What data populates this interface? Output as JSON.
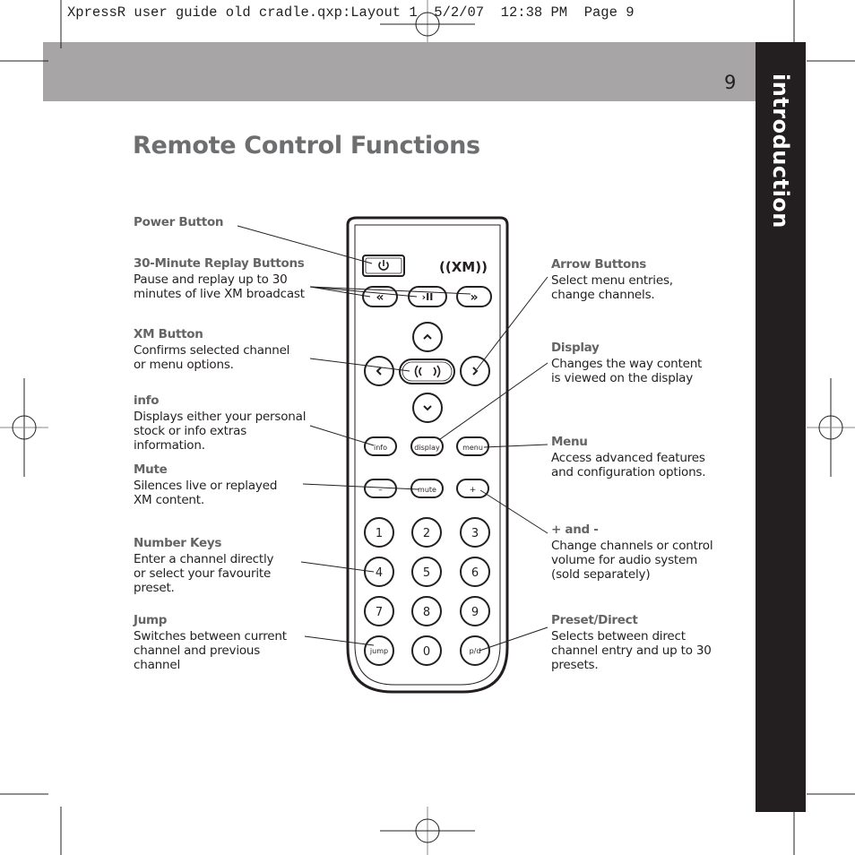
{
  "slug": "XpressR user guide old cradle.qxp:Layout 1  5/2/07  12:38 PM  Page 9",
  "page_number": "9",
  "section_tab": "introduction",
  "title": "Remote Control Functions",
  "colors": {
    "band": "#a7a5a6",
    "tab": "#231f20",
    "heading": "#636466",
    "title": "#6d6e70"
  },
  "left_callouts": [
    {
      "heading": "Power Button",
      "text": ""
    },
    {
      "heading": "30-Minute Replay Buttons",
      "text": "Pause and replay up to 30\nminutes of live XM broadcast"
    },
    {
      "heading": "XM Button",
      "text": "Confirms selected channel\nor menu options."
    },
    {
      "heading": "info",
      "text": "Displays either your personal\nstock or info extras\ninformation."
    },
    {
      "heading": "Mute",
      "text": "Silences live or replayed\nXM content."
    },
    {
      "heading": "Number Keys",
      "text": "Enter a channel directly\nor select your favourite\npreset."
    },
    {
      "heading": "Jump",
      "text": "Switches between current\nchannel and previous\nchannel"
    }
  ],
  "right_callouts": [
    {
      "heading": "Arrow Buttons",
      "text": "Select menu entries,\nchange channels."
    },
    {
      "heading": "Display",
      "text": "Changes the way content\nis viewed on the display"
    },
    {
      "heading": "Menu",
      "text": "Access advanced features\nand configuration options."
    },
    {
      "heading": "+ and -",
      "text": "Change channels or control\nvolume for audio system\n(sold separately)"
    },
    {
      "heading": "Preset/Direct",
      "text": "Selects between direct\nchannel entry and up to 30\npresets."
    }
  ],
  "remote": {
    "logo": "((XM))",
    "power_icon": "power-icon",
    "replay": [
      "«",
      "›II",
      "»"
    ],
    "up": "˄",
    "left": "‹",
    "center": "((( )))",
    "right": "›",
    "down": "˅",
    "info": "info",
    "display": "display",
    "menu": "menu",
    "minus": "–",
    "mute": "mute",
    "plus": "+",
    "keys": [
      "1",
      "2",
      "3",
      "4",
      "5",
      "6",
      "7",
      "8",
      "9"
    ],
    "jump": "jump",
    "zero": "0",
    "pd": "p/d"
  }
}
